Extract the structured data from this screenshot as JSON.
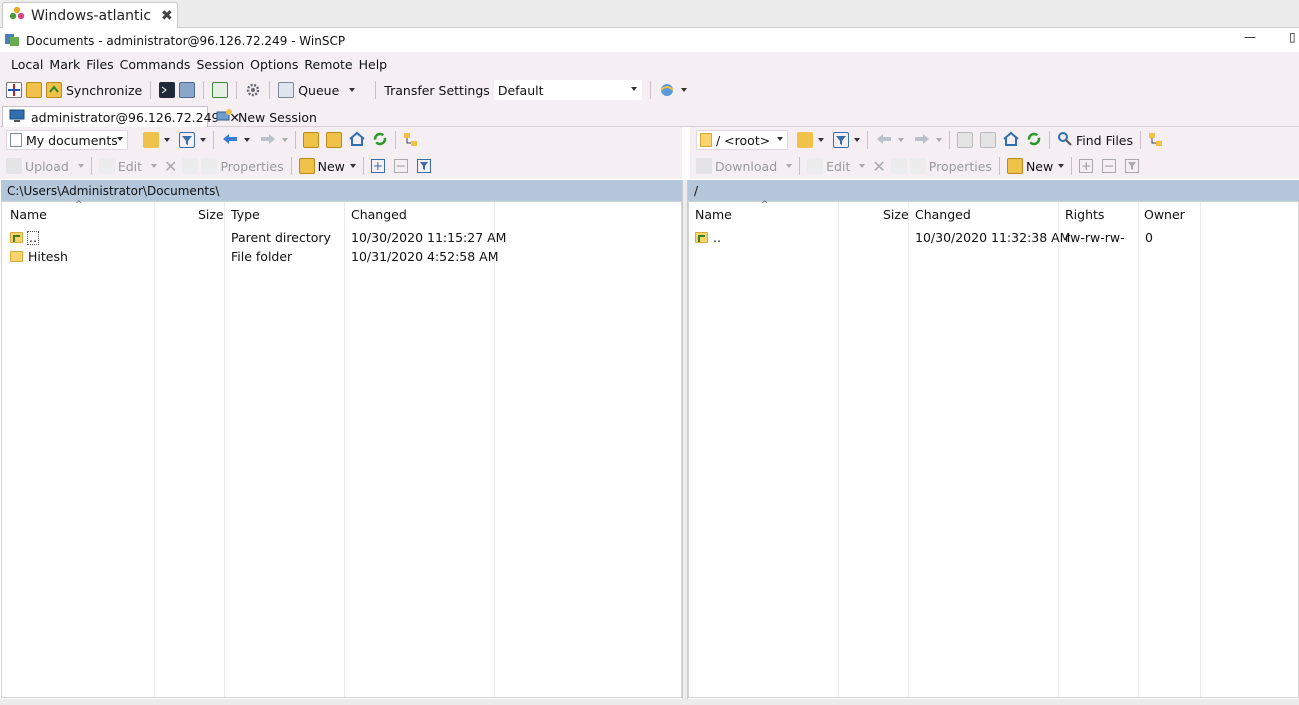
{
  "outer_tab": {
    "title": "Windows-atlantic",
    "close": "✖"
  },
  "window": {
    "title": "Documents - administrator@96.126.72.249 - WinSCP",
    "minimize": "—",
    "restore": "▯"
  },
  "menu": [
    "Local",
    "Mark",
    "Files",
    "Commands",
    "Session",
    "Options",
    "Remote",
    "Help"
  ],
  "toolbar": {
    "synchronize": "Synchronize",
    "queue": "Queue",
    "transfer_settings_label": "Transfer Settings",
    "transfer_settings_value": "Default"
  },
  "session_tabs": [
    {
      "label": "administrator@96.126.72.249",
      "close": "✕"
    },
    {
      "label": "New Session"
    }
  ],
  "local": {
    "location": "My documents",
    "buttons": {
      "upload": "Upload",
      "edit": "Edit",
      "properties": "Properties",
      "new": "New"
    },
    "path": "C:\\Users\\Administrator\\Documents\\",
    "columns": [
      "Name",
      "Size",
      "Type",
      "Changed"
    ],
    "rows": [
      {
        "name": "..",
        "size": "",
        "type": "Parent directory",
        "changed": "10/30/2020  11:15:27 AM"
      },
      {
        "name": "Hitesh",
        "size": "",
        "type": "File folder",
        "changed": "10/31/2020  4:52:58 AM"
      }
    ]
  },
  "remote": {
    "location": "/ <root>",
    "find_files": "Find Files",
    "buttons": {
      "download": "Download",
      "edit": "Edit",
      "properties": "Properties",
      "new": "New"
    },
    "path": "/",
    "columns": [
      "Name",
      "Size",
      "Changed",
      "Rights",
      "Owner"
    ],
    "rows": [
      {
        "name": "..",
        "size": "",
        "changed": "10/30/2020 11:32:38 AM",
        "rights": "rw-rw-rw-",
        "owner": "0"
      }
    ]
  },
  "colors": {
    "menu_bg": "#f5eef3",
    "path_bar": "#b4c7da",
    "folder": "#f7d46c"
  }
}
